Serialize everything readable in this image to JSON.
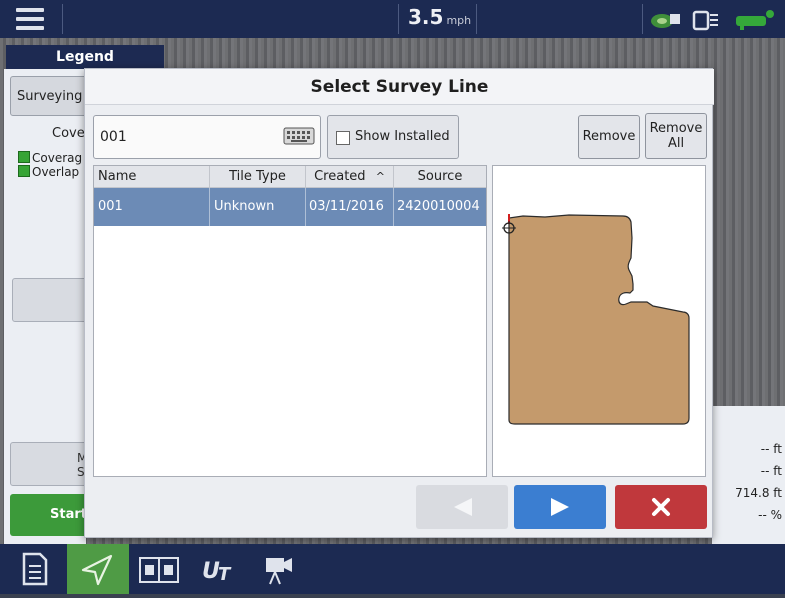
{
  "topbar": {
    "speed_value": "3.5",
    "speed_unit": "mph"
  },
  "legend": {
    "tab_label": "Legend",
    "surveying_label": "Surveying",
    "coverage_label": "Cove",
    "items": [
      "Coverag",
      "Overlap"
    ],
    "lower_button_text": "M S",
    "start_label": "Start"
  },
  "right_values": [
    "-- ft",
    "-- ft",
    "714.8 ft",
    "-- %"
  ],
  "dialog": {
    "title": "Select Survey Line",
    "name_value": "001",
    "show_installed_label": "Show Installed",
    "remove_label": "Remove",
    "remove_all_line1": "Remove",
    "remove_all_line2": "All",
    "columns": [
      "Name",
      "Tile Type",
      "Created",
      "Source"
    ],
    "sort_indicator": "^",
    "rows": [
      {
        "name": "001",
        "tile_type": "Unknown",
        "created": "03/11/2016",
        "source": "2420010004"
      }
    ]
  },
  "colors": {
    "selection": "#6c8bb6",
    "field_fill": "#c49a6c",
    "next_button": "#3b7ed1",
    "cancel_button": "#c0383c",
    "active_nav": "#4f9b45"
  },
  "icons": [
    "menu-icon",
    "satellite-icon",
    "signal-icon",
    "keyboard-icon",
    "prev-arrow-icon",
    "next-arrow-icon",
    "close-x-icon",
    "document-icon",
    "guidance-icon",
    "split-view-icon",
    "ut-icon",
    "camera-icon"
  ]
}
